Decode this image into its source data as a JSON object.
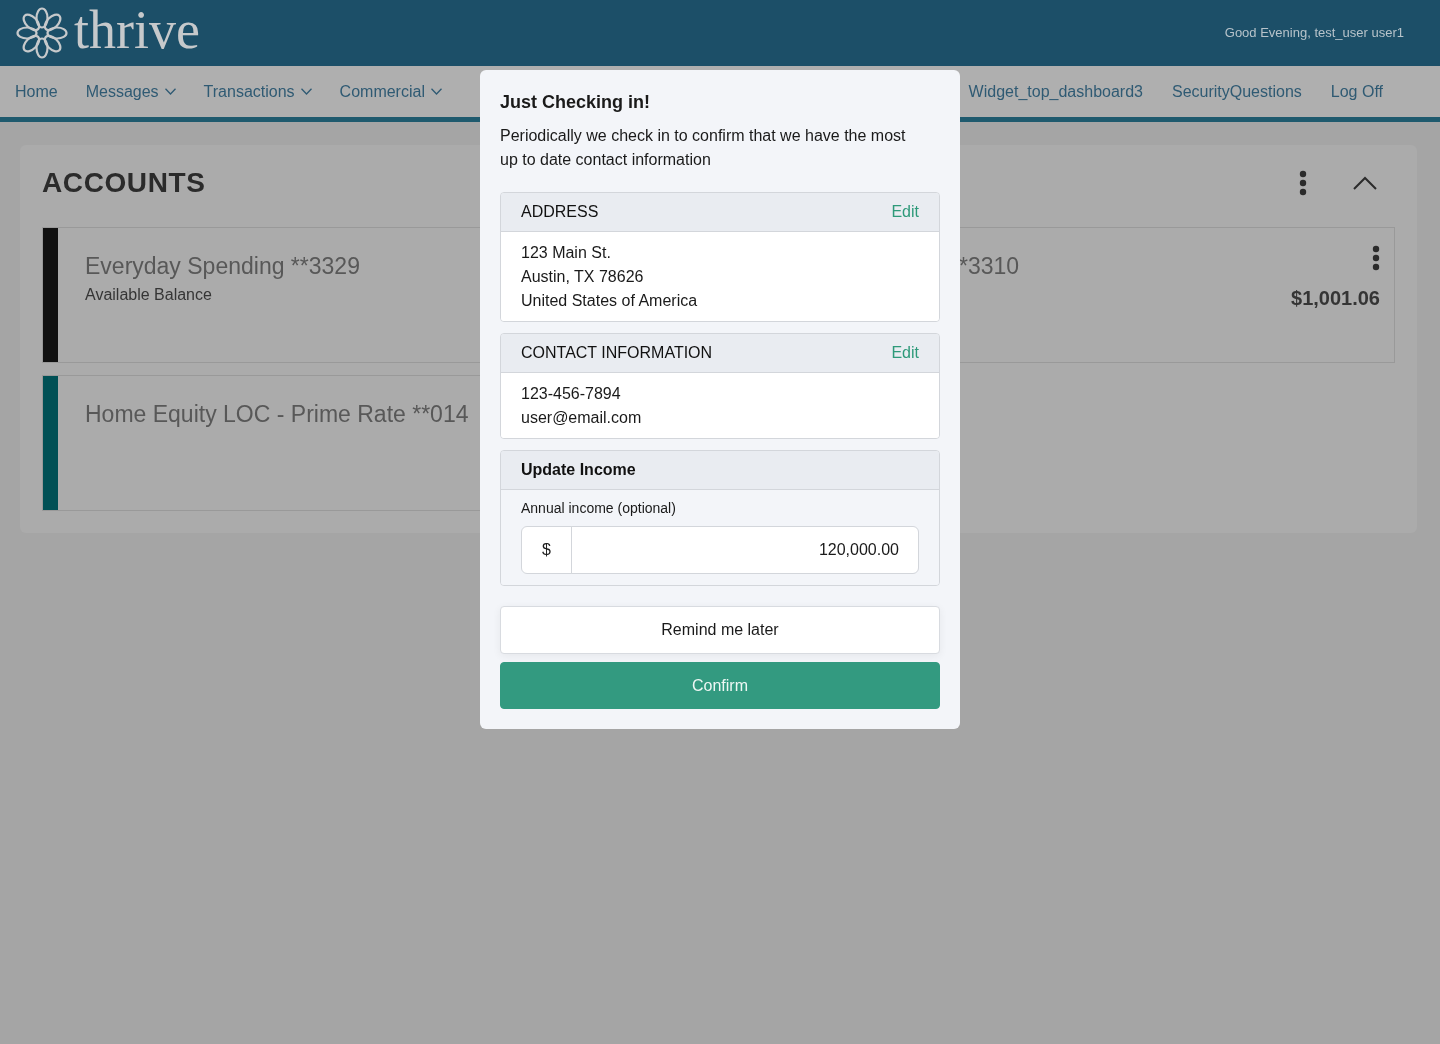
{
  "header": {
    "logo_text": "thrive",
    "greeting": "Good Evening, test_user user1"
  },
  "nav": {
    "left": [
      {
        "label": "Home",
        "dropdown": false
      },
      {
        "label": "Messages",
        "dropdown": true
      },
      {
        "label": "Transactions",
        "dropdown": true
      },
      {
        "label": "Commercial",
        "dropdown": true
      }
    ],
    "right": [
      {
        "label": "Widget_top_dashboard3",
        "dropdown": false
      },
      {
        "label": "SecurityQuestions",
        "dropdown": false
      },
      {
        "label": "Log Off",
        "dropdown": false
      }
    ]
  },
  "accounts_panel": {
    "title": "ACCOUNTS",
    "accounts": [
      {
        "name": "Everyday Spending **3329",
        "balance_label": "Available Balance",
        "color": "#111111"
      },
      {
        "name": "*3310",
        "balance": "$1,001.06"
      },
      {
        "name": "Home Equity LOC - Prime Rate **014",
        "color": "#005055"
      }
    ]
  },
  "modal": {
    "title": "Just Checking in!",
    "message": "Periodically we check in to confirm that we have the most up to date contact information",
    "sections": [
      {
        "kind": "info",
        "heading": "ADDRESS",
        "action": "Edit",
        "lines": [
          "123 Main St.",
          "Austin, TX 78626",
          "United States of America"
        ]
      },
      {
        "kind": "info",
        "heading": "CONTACT INFORMATION",
        "action": "Edit",
        "lines": [
          "123-456-7894",
          "user@email.com"
        ]
      },
      {
        "kind": "form",
        "heading": "Update Income",
        "field_label": "Annual income (optional)",
        "prefix": "$",
        "value": "120,000.00"
      }
    ],
    "buttons": [
      {
        "kind": "secondary",
        "label": "Remind me later"
      },
      {
        "kind": "primary",
        "label": "Confirm"
      }
    ]
  }
}
